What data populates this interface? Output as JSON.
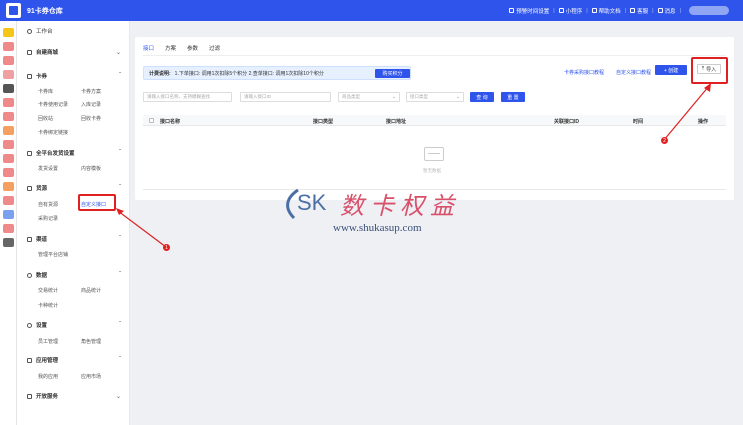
{
  "topbar": {
    "title": "91卡券仓库",
    "links": [
      "预警时间设置",
      "小程序",
      "帮助文档",
      "客服",
      "消息"
    ]
  },
  "sidebar": {
    "workbench": "工作台",
    "groups": [
      {
        "label": "自建商城",
        "expanded": false,
        "items": []
      },
      {
        "label": "卡券",
        "expanded": true,
        "items": [
          "卡券库",
          "卡券方案",
          "卡券使用记录",
          "入库记录",
          "回收站",
          "回收卡券",
          "卡券绑定链接"
        ]
      },
      {
        "label": "全平台发货设置",
        "expanded": true,
        "items": [
          "发货设置",
          "内容模板"
        ]
      },
      {
        "label": "货源",
        "expanded": true,
        "items": [
          "自有货源",
          "自定义接口",
          "采购记录"
        ]
      },
      {
        "label": "渠道",
        "expanded": true,
        "items": [
          "管理平台店铺"
        ]
      },
      {
        "label": "数据",
        "expanded": true,
        "items": [
          "交易统计",
          "商品统计",
          "卡种统计"
        ]
      },
      {
        "label": "设置",
        "expanded": true,
        "items": [
          "员工管理",
          "角色管理"
        ]
      },
      {
        "label": "应用管理",
        "expanded": true,
        "items": [
          "我的应用",
          "应用市场"
        ]
      },
      {
        "label": "开放服务",
        "expanded": false,
        "items": []
      }
    ]
  },
  "main": {
    "tabs": [
      "接口",
      "方案",
      "参数",
      "过滤"
    ],
    "billing": {
      "label": "计费说明:",
      "text": "1.下单接口: 调用1次扣除5个积分  2.查单接口: 调用1次扣除10个积分",
      "buy": "购买积分"
    },
    "links": {
      "tutorial": "卡券采购接口教程",
      "custom": "自定义接口教程"
    },
    "create": "+ 创建",
    "import": "导入",
    "filters": {
      "f1": "请输入接口名称、支持模糊查找",
      "f2": "请输入接口ID",
      "f3": "商品类型",
      "f4": "接口类型",
      "search": "查 询",
      "reset": "重 置"
    },
    "columns": [
      "接口名称",
      "接口类型",
      "接口地址",
      "关联接口ID",
      "时间",
      "操作"
    ],
    "empty": "暂无数据"
  },
  "annotations": {
    "m1": "1",
    "m2": "2"
  },
  "watermark": {
    "logo": "SK",
    "brand": "数卡权益",
    "url": "www.shukasup.com"
  },
  "colors": {
    "primary": "#2f54eb",
    "highlight": "#e02020"
  }
}
